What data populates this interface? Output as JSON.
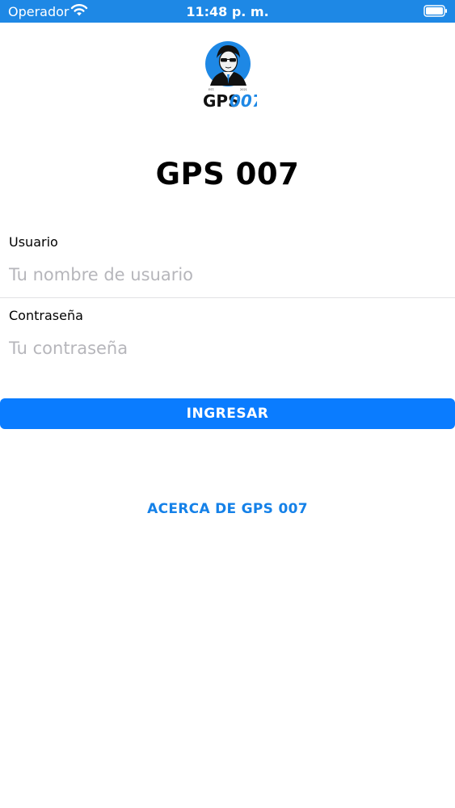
{
  "status_bar": {
    "carrier": "Operador",
    "time": "11:48 p. m.",
    "wifi_icon": "wifi-icon",
    "battery_icon": "battery-icon",
    "background_color": "#1e88e5"
  },
  "logo": {
    "text_gps": "GPS",
    "text_007": "007",
    "brand_color": "#1e88e5"
  },
  "app_title": "GPS 007",
  "login_form": {
    "username_label": "Usuario",
    "username_placeholder": "Tu nombre de usuario",
    "username_value": "",
    "password_label": "Contraseña",
    "password_placeholder": "Tu contraseña",
    "password_value": ""
  },
  "login_button": {
    "label": "INGRESAR",
    "color": "#0a7cff"
  },
  "about_link": {
    "label": "ACERCA DE GPS 007",
    "color": "#1581e8"
  }
}
